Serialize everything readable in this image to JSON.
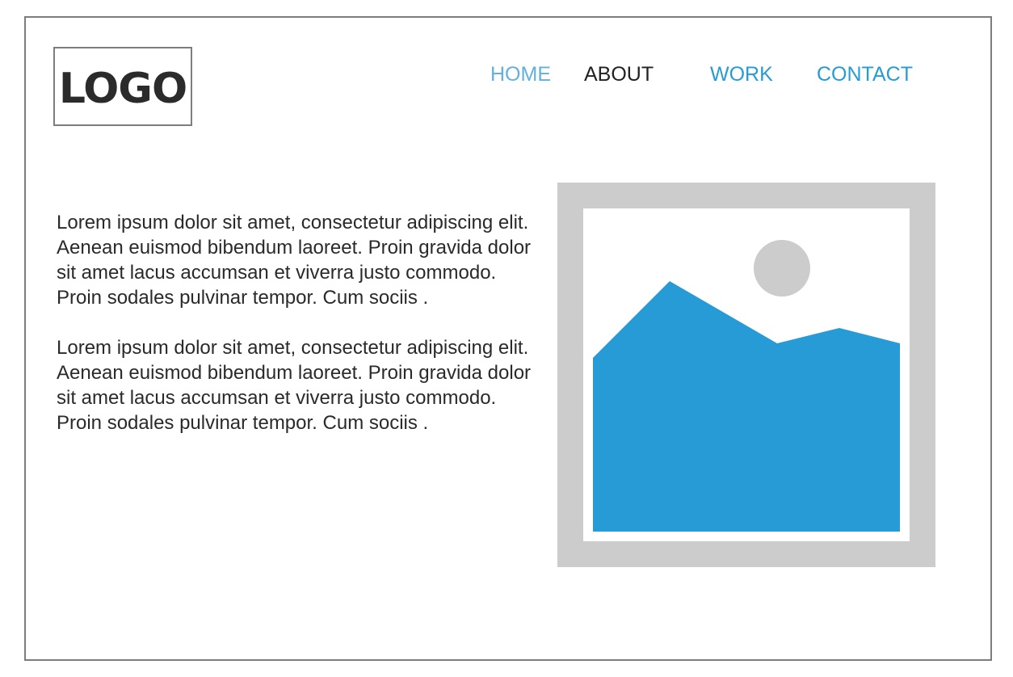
{
  "header": {
    "logo_text": "LOGO"
  },
  "nav": {
    "items": [
      {
        "label": "HOME"
      },
      {
        "label": "ABOUT"
      },
      {
        "label": "WORK"
      },
      {
        "label": "CONTACT"
      }
    ]
  },
  "content": {
    "paragraphs": [
      "Lorem ipsum dolor sit amet, consectetur adipiscing elit. Aenean euismod bibendum laoreet. Proin gravida dolor sit amet lacus accumsan et viverra justo commodo. Proin sodales pulvinar tempor. Cum sociis .",
      "Lorem ipsum dolor sit amet, consectetur adipiscing elit. Aenean euismod bibendum laoreet. Proin gravida dolor sit amet lacus accumsan et viverra justo commodo. Proin sodales pulvinar tempor. Cum sociis ."
    ]
  },
  "image": {
    "icon": "image-placeholder-icon"
  },
  "colors": {
    "nav_active": "#63b0dc",
    "nav_link": "#269bd5",
    "nav_text": "#222222",
    "placeholder_frame": "#cccccc",
    "placeholder_mountain": "#269bd5",
    "border": "#7d7d7d"
  }
}
